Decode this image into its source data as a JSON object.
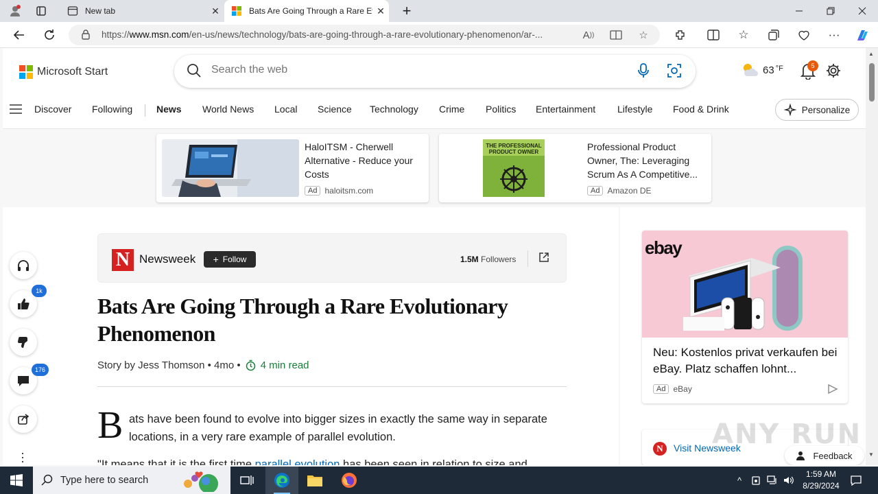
{
  "browser": {
    "tabs": [
      {
        "title": "New tab",
        "active": false
      },
      {
        "title": "Bats Are Going Through a Rare Evolutionary Phenomenon",
        "active": true
      }
    ],
    "new_tab_symbol": "+",
    "url_prefix": "https://",
    "url_domain": "www.msn.com",
    "url_path": "/en-us/news/technology/bats-are-going-through-a-rare-evolutionary-phenomenon/ar-..."
  },
  "header": {
    "brand": "Microsoft Start",
    "search_placeholder": "Search the web",
    "weather": "63",
    "weather_unit": "°F",
    "notification_count": "5"
  },
  "nav": {
    "items": [
      "Discover",
      "Following",
      "News",
      "World News",
      "Local",
      "Science",
      "Technology",
      "Crime",
      "Politics",
      "Entertainment",
      "Lifestyle",
      "Food & Drink"
    ],
    "active": "News",
    "personalize": "Personalize"
  },
  "ads": [
    {
      "title": "HaloITSM - Cherwell Alternative - Reduce your Costs",
      "label": "Ad",
      "source": "haloitsm.com",
      "image_text": ""
    },
    {
      "title": "Professional Product Owner, The: Leveraging Scrum As A Competitive...",
      "label": "Ad",
      "source": "Amazon DE",
      "image_text": "THE PROFESSIONAL PRODUCT OWNER"
    }
  ],
  "publisher": {
    "logo_letter": "N",
    "name": "Newsweek",
    "follow": "Follow",
    "followers_count": "1.5M",
    "followers_label": "Followers"
  },
  "article": {
    "title": "Bats Are Going Through a Rare Evolutionary Phenomenon",
    "byline": "Story by Jess Thomson • 4mo •",
    "read_time": "4 min read",
    "dropcap": "B",
    "para1": "ats have been found to evolve into bigger sizes in exactly the same way in separate locations, in a very rare example of parallel evolution.",
    "para2_start": "\"It means that it is the first time ",
    "para2_link": "parallel evolution",
    "para2_end": " has been seen in relation to size and"
  },
  "side_actions": {
    "likes": "1k",
    "comments": "176"
  },
  "right_ad": {
    "brand": "ebay",
    "title": "Neu: Kostenlos privat verkaufen bei eBay. Platz schaffen lohnt...",
    "label": "Ad",
    "source": "eBay"
  },
  "visit": {
    "text": "Visit Newsweek",
    "logo_letter": "N"
  },
  "feedback": "Feedback",
  "watermark": "ANY RUN",
  "taskbar": {
    "search_placeholder": "Type here to search",
    "time": "1:59 AM",
    "date": "8/29/2024"
  },
  "colors": {
    "accent": "#0067b8",
    "newsweek_red": "#d52221",
    "read_time_green": "#188038",
    "ebay_bg": "#f6c9d4"
  }
}
